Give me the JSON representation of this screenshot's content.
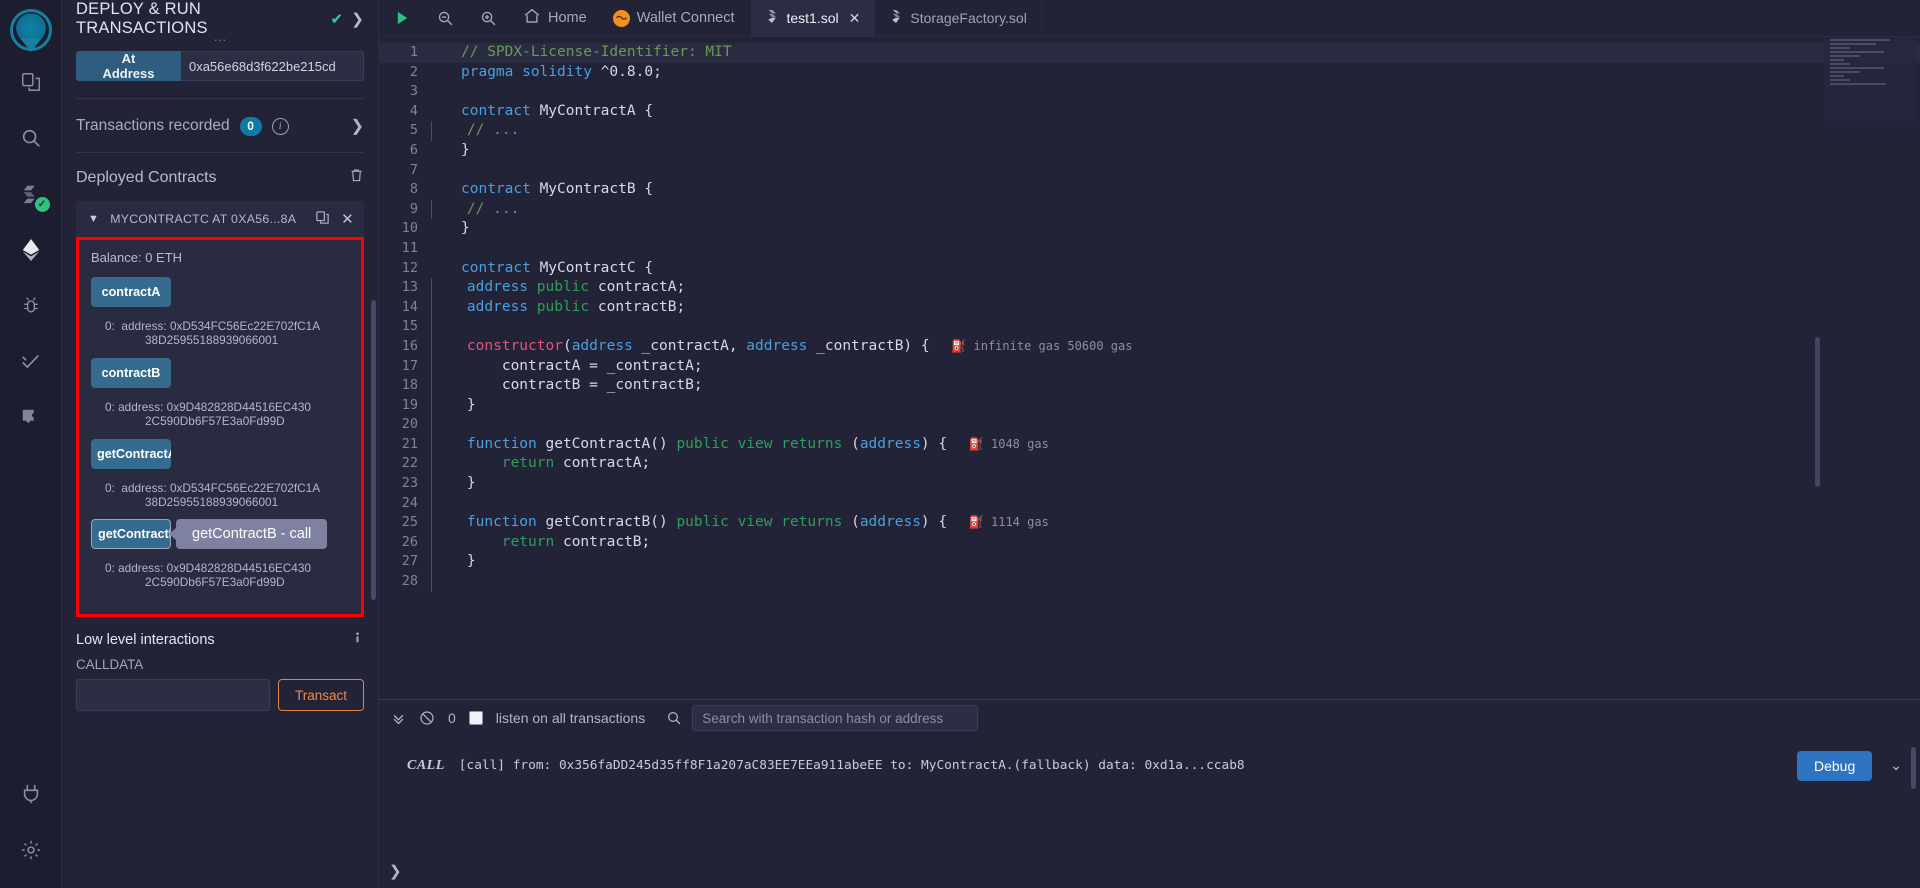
{
  "iconbar": {
    "logo_name": "remix-logo",
    "items": [
      {
        "name": "file-explorer-icon",
        "label": "File explorer"
      },
      {
        "name": "search-icon",
        "label": "Search in files"
      },
      {
        "name": "solidity-compiler-icon",
        "label": "Solidity compiler"
      },
      {
        "name": "deploy-run-icon",
        "label": "Deploy & run transactions"
      },
      {
        "name": "debugger-icon",
        "label": "Debugger"
      },
      {
        "name": "solidity-unit-testing-icon",
        "label": "Solidity unit testing"
      },
      {
        "name": "plugin-manager-icon",
        "label": "Plugin manager"
      }
    ],
    "bottom_items": [
      {
        "name": "remixd-plug-icon",
        "label": "Remixd"
      },
      {
        "name": "settings-gear-icon",
        "label": "Settings"
      }
    ]
  },
  "panel": {
    "title": "DEPLOY & RUN TRANSACTIONS",
    "at_address_label": "At Address",
    "at_address_value": "0xa56e68d3f622be215cd",
    "transactions_recorded_label": "Transactions recorded",
    "transactions_recorded_count": "0",
    "deployed_contracts_label": "Deployed Contracts",
    "contract": {
      "header": "MYCONTRACTC AT 0XA56...8A",
      "balance": "Balance: 0 ETH",
      "functions": [
        {
          "label": "contractA",
          "result_index": "0:",
          "result_type": "address:",
          "result_value_line1": "0xD534FC56Ec22E702fC1A",
          "result_value_line2": "38D25955188939066001"
        },
        {
          "label": "contractB",
          "result_index": "0:",
          "result_type": "address:",
          "result_value_line1": "0x9D482828D44516EC430",
          "result_value_line2": "2C590Db6F57E3a0Fd99D"
        },
        {
          "label": "getContractA",
          "result_index": "0:",
          "result_type": "address:",
          "result_value_line1": "0xD534FC56Ec22E702fC1A",
          "result_value_line2": "38D25955188939066001"
        },
        {
          "label": "getContractB",
          "tooltip": "getContractB - call",
          "result_index": "0:",
          "result_type": "address:",
          "result_value_line1": "0x9D482828D44516EC430",
          "result_value_line2": "2C590Db6F57E3a0Fd99D"
        }
      ]
    },
    "low_level": {
      "title": "Low level interactions",
      "calldata_label": "CALLDATA",
      "calldata_value": "",
      "transact_label": "Transact"
    }
  },
  "topbar": {
    "run_label": "run",
    "zoom_out_label": "zoom out",
    "zoom_in_label": "zoom in",
    "home_label": "Home",
    "wallet_connect_label": "Wallet Connect",
    "tabs": [
      {
        "label": "test1.sol",
        "active": true,
        "closable": true
      },
      {
        "label": "StorageFactory.sol",
        "active": false,
        "closable": false
      }
    ]
  },
  "editor": {
    "lines": [
      {
        "n": "1",
        "tokens": [
          {
            "t": "// SPDX-License-Identifier: MIT",
            "c": "c-com"
          }
        ],
        "highlight": true
      },
      {
        "n": "2",
        "tokens": [
          {
            "t": "pragma",
            "c": "c-kw"
          },
          {
            "t": " ",
            "c": "c-pun"
          },
          {
            "t": "solidity",
            "c": "c-typ"
          },
          {
            "t": " ^0.8.0;",
            "c": "c-pun"
          }
        ]
      },
      {
        "n": "3",
        "tokens": []
      },
      {
        "n": "4",
        "tokens": [
          {
            "t": "contract",
            "c": "c-kw"
          },
          {
            "t": " MyContractA {",
            "c": "c-pun"
          }
        ]
      },
      {
        "n": "5",
        "tokens": [
          {
            "t": "    // ...",
            "c": "c-com"
          }
        ],
        "guide": true
      },
      {
        "n": "6",
        "tokens": [
          {
            "t": "}",
            "c": "c-pun"
          }
        ]
      },
      {
        "n": "7",
        "tokens": []
      },
      {
        "n": "8",
        "tokens": [
          {
            "t": "contract",
            "c": "c-kw"
          },
          {
            "t": " MyContractB {",
            "c": "c-pun"
          }
        ]
      },
      {
        "n": "9",
        "tokens": [
          {
            "t": "    // ...",
            "c": "c-com"
          }
        ],
        "guide": true
      },
      {
        "n": "10",
        "tokens": [
          {
            "t": "}",
            "c": "c-pun"
          }
        ]
      },
      {
        "n": "11",
        "tokens": []
      },
      {
        "n": "12",
        "tokens": [
          {
            "t": "contract",
            "c": "c-kw"
          },
          {
            "t": " MyContractC {",
            "c": "c-pun"
          }
        ]
      },
      {
        "n": "13",
        "tokens": [
          {
            "t": "    ",
            "c": "c-pun"
          },
          {
            "t": "address",
            "c": "c-typ"
          },
          {
            "t": " ",
            "c": "c-pun"
          },
          {
            "t": "public",
            "c": "c-grn"
          },
          {
            "t": " contractA;",
            "c": "c-pun"
          }
        ],
        "guide": true
      },
      {
        "n": "14",
        "tokens": [
          {
            "t": "    ",
            "c": "c-pun"
          },
          {
            "t": "address",
            "c": "c-typ"
          },
          {
            "t": " ",
            "c": "c-pun"
          },
          {
            "t": "public",
            "c": "c-grn"
          },
          {
            "t": " contractB;",
            "c": "c-pun"
          }
        ],
        "guide": true
      },
      {
        "n": "15",
        "tokens": [],
        "guide": true
      },
      {
        "n": "16",
        "tokens": [
          {
            "t": "    ",
            "c": "c-pun"
          },
          {
            "t": "constructor",
            "c": "c-ctor"
          },
          {
            "t": "(",
            "c": "c-pun"
          },
          {
            "t": "address",
            "c": "c-typ"
          },
          {
            "t": " _contractA, ",
            "c": "c-pun"
          },
          {
            "t": "address",
            "c": "c-typ"
          },
          {
            "t": " _contractB) {",
            "c": "c-pun"
          }
        ],
        "guide": true,
        "gas": "infinite gas 50600 gas"
      },
      {
        "n": "17",
        "tokens": [
          {
            "t": "        contractA = _contractA;",
            "c": "c-pun"
          }
        ],
        "guide": true
      },
      {
        "n": "18",
        "tokens": [
          {
            "t": "        contractB = _contractB;",
            "c": "c-pun"
          }
        ],
        "guide": true
      },
      {
        "n": "19",
        "tokens": [
          {
            "t": "    }",
            "c": "c-pun"
          }
        ],
        "guide": true
      },
      {
        "n": "20",
        "tokens": [],
        "guide": true
      },
      {
        "n": "21",
        "tokens": [
          {
            "t": "    ",
            "c": "c-pun"
          },
          {
            "t": "function",
            "c": "c-kw"
          },
          {
            "t": " getContractA() ",
            "c": "c-pun"
          },
          {
            "t": "public",
            "c": "c-grn"
          },
          {
            "t": " ",
            "c": "c-pun"
          },
          {
            "t": "view",
            "c": "c-grn"
          },
          {
            "t": " ",
            "c": "c-pun"
          },
          {
            "t": "returns",
            "c": "c-grn"
          },
          {
            "t": " (",
            "c": "c-pun"
          },
          {
            "t": "address",
            "c": "c-typ"
          },
          {
            "t": ") {",
            "c": "c-pun"
          }
        ],
        "guide": true,
        "gas": "1048 gas"
      },
      {
        "n": "22",
        "tokens": [
          {
            "t": "        ",
            "c": "c-pun"
          },
          {
            "t": "return",
            "c": "c-grn"
          },
          {
            "t": " contractA;",
            "c": "c-pun"
          }
        ],
        "guide": true
      },
      {
        "n": "23",
        "tokens": [
          {
            "t": "    }",
            "c": "c-pun"
          }
        ],
        "guide": true
      },
      {
        "n": "24",
        "tokens": [],
        "guide": true
      },
      {
        "n": "25",
        "tokens": [
          {
            "t": "    ",
            "c": "c-pun"
          },
          {
            "t": "function",
            "c": "c-kw"
          },
          {
            "t": " getContractB() ",
            "c": "c-pun"
          },
          {
            "t": "public",
            "c": "c-grn"
          },
          {
            "t": " ",
            "c": "c-pun"
          },
          {
            "t": "view",
            "c": "c-grn"
          },
          {
            "t": " ",
            "c": "c-pun"
          },
          {
            "t": "returns",
            "c": "c-grn"
          },
          {
            "t": " (",
            "c": "c-pun"
          },
          {
            "t": "address",
            "c": "c-typ"
          },
          {
            "t": ") {",
            "c": "c-pun"
          }
        ],
        "guide": true,
        "gas": "1114 gas"
      },
      {
        "n": "26",
        "tokens": [
          {
            "t": "        ",
            "c": "c-pun"
          },
          {
            "t": "return",
            "c": "c-grn"
          },
          {
            "t": " contractB;",
            "c": "c-pun"
          }
        ],
        "guide": true
      },
      {
        "n": "27",
        "tokens": [
          {
            "t": "    }",
            "c": "c-pun"
          }
        ],
        "guide": true
      },
      {
        "n": "28",
        "tokens": [],
        "guide": true
      }
    ]
  },
  "terminal": {
    "pending_count": "0",
    "listen_label": "listen on all transactions",
    "search_placeholder": "Search with transaction hash or address",
    "log": {
      "call_label": "CALL",
      "text": "[call] from: 0x356faDD245d35ff8F1a207aC83EE7EEa911abeEE to: MyContractA.(fallback) data: 0xd1a...ccab8"
    },
    "debug_label": "Debug"
  }
}
